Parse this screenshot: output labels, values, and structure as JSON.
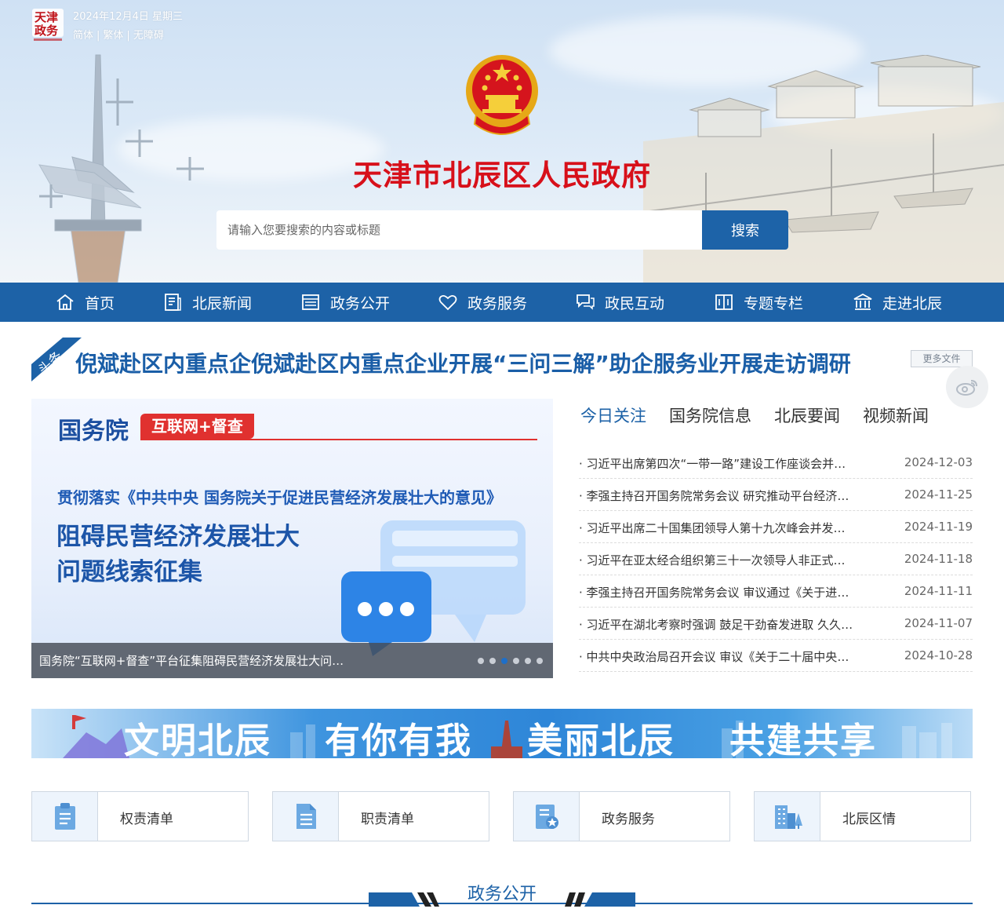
{
  "header": {
    "date": "2024年12月4日 星期三",
    "lang_links": [
      "简体",
      "繁体",
      "无障碍"
    ],
    "site_title": "天津市北辰区人民政府",
    "search_placeholder": "请输入您要搜索的内容或标题",
    "search_button": "搜索",
    "logo_text": [
      "天津",
      "政务"
    ]
  },
  "nav": {
    "items": [
      {
        "label": "首页",
        "icon": "home-icon"
      },
      {
        "label": "北辰新闻",
        "icon": "news-icon"
      },
      {
        "label": "政务公开",
        "icon": "open-gov-icon"
      },
      {
        "label": "政务服务",
        "icon": "service-icon"
      },
      {
        "label": "政民互动",
        "icon": "interaction-icon"
      },
      {
        "label": "专题专栏",
        "icon": "column-icon"
      },
      {
        "label": "走进北辰",
        "icon": "building-icon"
      }
    ]
  },
  "headline": {
    "tag": "头条",
    "text": "倪斌赴区内重点企倪斌赴区内重点企业开展“三问三解”助企服务业开展走访调研",
    "more": "更多文件"
  },
  "slider": {
    "org": "国务院",
    "badge": "互联网+督查",
    "subtitle": "贯彻落实《中共中央 国务院关于促进民营经济发展壮大的意见》",
    "main_line1": "阻碍民营经济发展壮大",
    "main_line2": "问题线索征集",
    "caption": "国务院“互联网+督查”平台征集阻碍民营经济发展壮大问题线索",
    "dots": 6,
    "active_dot": 2
  },
  "news": {
    "tabs": [
      "今日关注",
      "国务院信息",
      "北辰要闻",
      "视频新闻"
    ],
    "active_tab": 0,
    "items": [
      {
        "title": "· 习近平出席第四次“一带一路”建设工作座谈会并发表重要讲话",
        "date": "2024-12-03"
      },
      {
        "title": "· 李强主持召开国务院常务会议 研究推动平台经济健康发展",
        "date": "2024-11-25"
      },
      {
        "title": "· 习近平出席二十国集团领导人第十九次峰会并发表重要讲话",
        "date": "2024-11-19"
      },
      {
        "title": "· 习近平在亚太经合组织第三十一次领导人非正式会议上发表讲话",
        "date": "2024-11-18"
      },
      {
        "title": "· 李强主持召开国务院常务会议 审议通过《关于进一步做好就业工作》",
        "date": "2024-11-11"
      },
      {
        "title": "· 习近平在湖北考察时强调 鼓足干劲奋发进取 久久为功",
        "date": "2024-11-07"
      },
      {
        "title": "· 中共中央政治局召开会议 审议《关于二十届中央第三轮巡视》",
        "date": "2024-10-28"
      }
    ]
  },
  "banner": {
    "phrases": [
      "文明北辰",
      "有你有我",
      "美丽北辰",
      "共建共享"
    ]
  },
  "quick_links": [
    {
      "label": "权责清单",
      "icon": "clipboard-icon"
    },
    {
      "label": "职责清单",
      "icon": "document-icon"
    },
    {
      "label": "政务服务",
      "icon": "service-doc-icon"
    },
    {
      "label": "北辰区情",
      "icon": "city-icon"
    }
  ],
  "section": {
    "title": "政务公开"
  },
  "colors": {
    "brand_blue": "#1d62a7",
    "title_red": "#d7101a",
    "badge_red": "#e0312f"
  }
}
